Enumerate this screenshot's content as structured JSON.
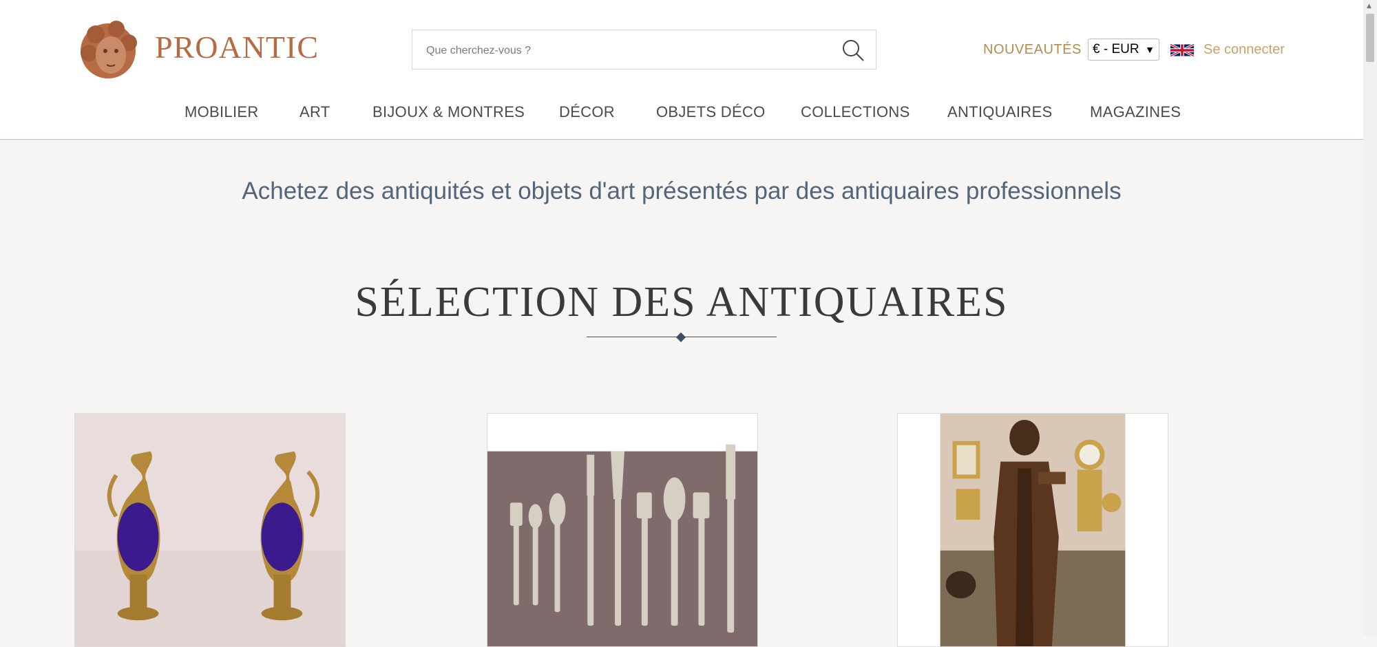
{
  "header": {
    "logo_text": "PROANTIC",
    "search_placeholder": "Que cherchez-vous ?",
    "nouveautes": "NOUVEAUTÉS",
    "currency": "€ - EUR",
    "login": "Se connecter"
  },
  "nav": {
    "items": [
      {
        "label": "MOBILIER"
      },
      {
        "label": "ART"
      },
      {
        "label": "BIJOUX & MONTRES"
      },
      {
        "label": "DÉCOR"
      },
      {
        "label": "OBJETS DÉCO"
      },
      {
        "label": "COLLECTIONS"
      },
      {
        "label": "ANTIQUAIRES"
      },
      {
        "label": "MAGAZINES"
      }
    ]
  },
  "main": {
    "tagline": "Achetez des antiquités et objets d'art présentés par des antiquaires professionnels",
    "section_title": "SÉLECTION DES ANTIQUAIRES"
  },
  "products": [
    {
      "image": "vases-image"
    },
    {
      "image": "cutlery-image"
    },
    {
      "image": "statue-image"
    }
  ],
  "colors": {
    "brand": "#b66b44",
    "accent_gold": "#b48c4e",
    "tagline_blue": "#52657a"
  }
}
